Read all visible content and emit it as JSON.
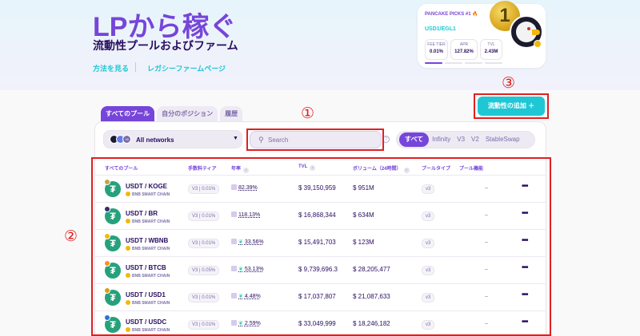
{
  "hero": {
    "title": "LPから稼ぐ",
    "subtitle": "流動性プールおよびファーム",
    "link_howto": "方法を見る",
    "link_legacy": "レガシーファームページ"
  },
  "pick": {
    "title": "PANCAKE PICKS #1 🔥",
    "pair": "USD1/EGL1",
    "rank": "1",
    "stats": [
      {
        "label": "FEE TIER",
        "value": "0.01%"
      },
      {
        "label": "APR",
        "value": "127.82%"
      },
      {
        "label": "TVL",
        "value": "2.43M"
      }
    ]
  },
  "add_liquidity_label": "流動性の追加 ＋",
  "tabs": [
    "すべてのプール",
    "自分のポジション",
    "履歴"
  ],
  "network_select": {
    "label": "All networks",
    "more_badge": "+6"
  },
  "search": {
    "placeholder": "Search",
    "value": ""
  },
  "filters": [
    "すべて",
    "Infinity",
    "V3",
    "V2",
    "StableSwap"
  ],
  "table": {
    "headers": {
      "pool": "すべてのプール",
      "fee": "手数料ティア",
      "apr": "年率",
      "tvl": "TVL",
      "volume": "ボリューム（24時間）",
      "type": "プールタイプ",
      "feature": "プール機能"
    },
    "rows": [
      {
        "pair": "USDT / KOGE",
        "chain": "BNB SMART CHAIN",
        "fee": "V3 | 0.01%",
        "apr": "82.39%",
        "farm": false,
        "tvl": "$ 39,150,959",
        "volume": "$ 951M",
        "type": "v3",
        "feature": "–",
        "color2": "#c8a24a"
      },
      {
        "pair": "USDT / BR",
        "chain": "BNB SMART CHAIN",
        "fee": "V3 | 0.01%",
        "apr": "118.13%",
        "farm": false,
        "tvl": "$ 16,868,344",
        "volume": "$ 634M",
        "type": "v3",
        "feature": "–",
        "color2": "#3b2a6b"
      },
      {
        "pair": "USDT / WBNB",
        "chain": "BNB SMART CHAIN",
        "fee": "V3 | 0.01%",
        "apr": "33.56%",
        "farm": true,
        "tvl": "$ 15,491,703",
        "volume": "$ 123M",
        "type": "v3",
        "feature": "–",
        "color2": "#f0b90b"
      },
      {
        "pair": "USDT / BTCB",
        "chain": "BNB SMART CHAIN",
        "fee": "V3 | 0.05%",
        "apr": "53.13%",
        "farm": true,
        "tvl": "$ 9,739,696.3",
        "volume": "$ 28,205,477",
        "type": "v3",
        "feature": "–",
        "color2": "#f7931a"
      },
      {
        "pair": "USDT / USD1",
        "chain": "BNB SMART CHAIN",
        "fee": "V3 | 0.01%",
        "apr": "4.48%",
        "farm": true,
        "tvl": "$ 17,037,807",
        "volume": "$ 21,087,633",
        "type": "v3",
        "feature": "–",
        "color2": "#d4a017"
      },
      {
        "pair": "USDT / USDC",
        "chain": "BNB SMART CHAIN",
        "fee": "V3 | 0.01%",
        "apr": "2.59%",
        "farm": true,
        "tvl": "$ 33,049,999",
        "volume": "$ 18,246,182",
        "type": "v3",
        "feature": "–",
        "color2": "#2775ca"
      }
    ]
  },
  "annotations": [
    "①",
    "②",
    "③"
  ]
}
